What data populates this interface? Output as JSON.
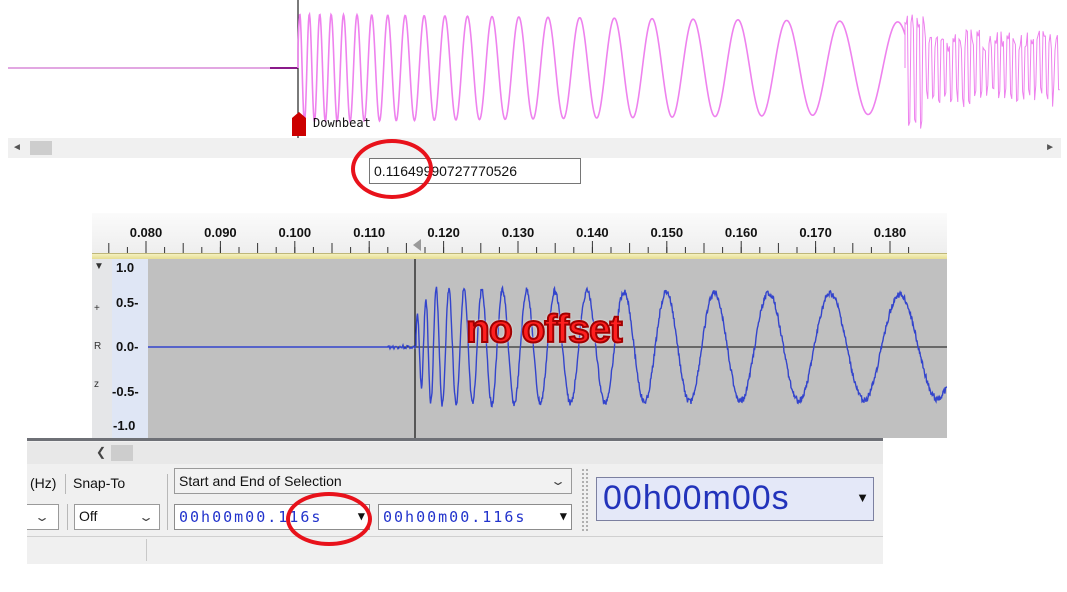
{
  "top_panel": {
    "marker_label": "Downbeat",
    "wave_color": "#ee82ee",
    "marker_color": "#cc0000",
    "value_field": "0.11649990727770526"
  },
  "ruler": {
    "ticks": [
      "0.080",
      "0.090",
      "0.100",
      "0.110",
      "0.120",
      "0.130",
      "0.140",
      "0.150",
      "0.160",
      "0.170",
      "0.180"
    ]
  },
  "vertical_ruler": {
    "labels": [
      "1.0",
      "0.5-",
      "0.0-",
      "-0.5-",
      "-1.0"
    ]
  },
  "track": {
    "wave_color": "#3344cc",
    "background": "#c0c0c0"
  },
  "annotation": {
    "caption": "no offset",
    "color": "#ff1f1f"
  },
  "toolbar": {
    "rate_label": "(Hz)",
    "snap_label": "Snap-To",
    "snap_value": "Off",
    "selection_mode": "Start and End of Selection",
    "start_time": "00h00m00.116s",
    "end_time": "00h00m00.116s",
    "audio_position": "00h00m00s"
  }
}
